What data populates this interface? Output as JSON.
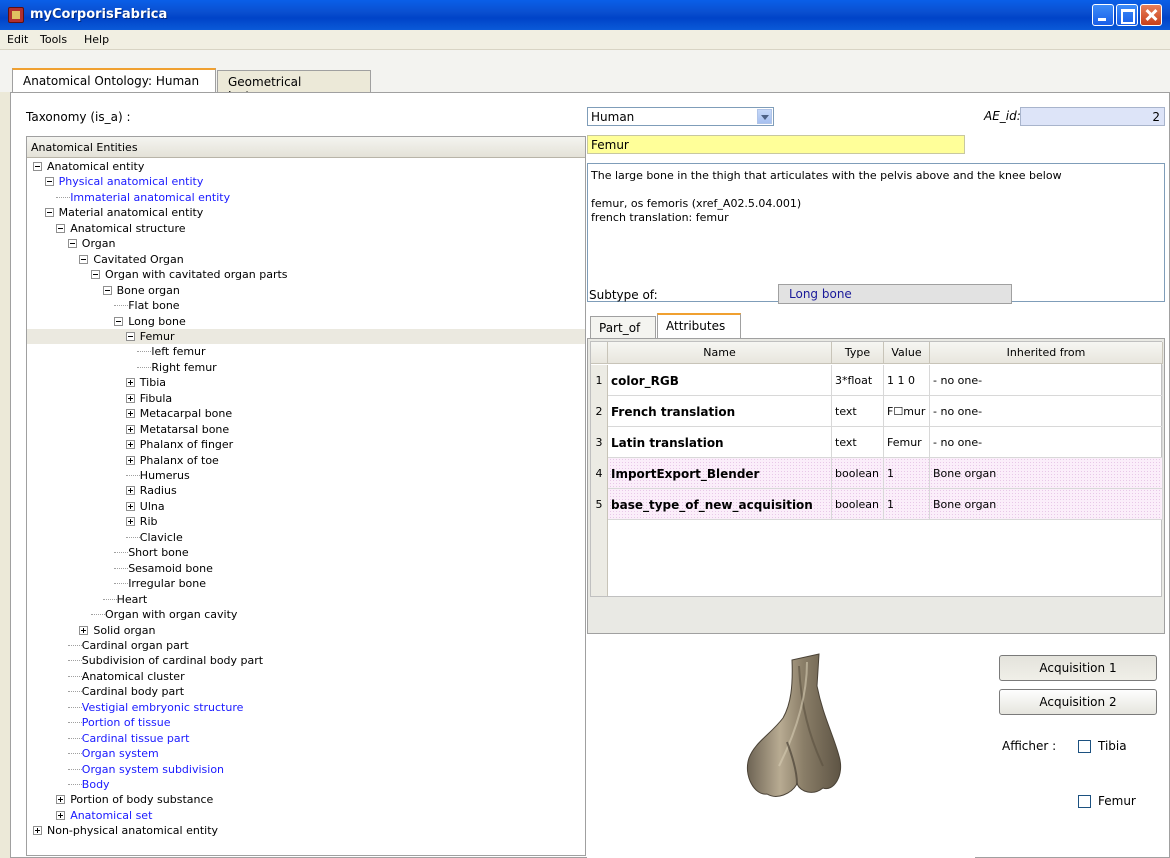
{
  "window": {
    "title": "myCorporisFabrica"
  },
  "menu": [
    "Edit",
    "Tools",
    "Help"
  ],
  "tabs": [
    "Anatomical Ontology: Human",
    "Geometrical Instances"
  ],
  "taxonomy_label": "Taxonomy (is_a) :",
  "tree_header": "Anatomical Entities",
  "tree": [
    {
      "label": "Anatomical entity",
      "exp": "minus"
    },
    {
      "label": "Physical anatomical entity",
      "exp": "minus",
      "blue": true
    },
    {
      "label": "Immaterial anatomical entity",
      "exp": "leaf",
      "blue": true
    },
    {
      "label": "Material anatomical entity",
      "exp": "minus"
    },
    {
      "label": "Anatomical structure",
      "exp": "minus"
    },
    {
      "label": "Organ",
      "exp": "minus"
    },
    {
      "label": "Cavitated Organ",
      "exp": "minus"
    },
    {
      "label": "Organ with cavitated organ parts",
      "exp": "minus"
    },
    {
      "label": "Bone organ",
      "exp": "minus"
    },
    {
      "label": "Flat bone",
      "exp": "leaf"
    },
    {
      "label": "Long bone",
      "exp": "minus"
    },
    {
      "label": "Femur",
      "exp": "minus",
      "selected": true
    },
    {
      "label": "left femur",
      "exp": "leaf"
    },
    {
      "label": "Right femur",
      "exp": "leaf"
    },
    {
      "label": "Tibia",
      "exp": "plus"
    },
    {
      "label": "Fibula",
      "exp": "plus"
    },
    {
      "label": "Metacarpal bone",
      "exp": "plus"
    },
    {
      "label": "Metatarsal bone",
      "exp": "plus"
    },
    {
      "label": "Phalanx of finger",
      "exp": "plus"
    },
    {
      "label": "Phalanx of toe",
      "exp": "plus"
    },
    {
      "label": "Humerus",
      "exp": "leaf"
    },
    {
      "label": "Radius",
      "exp": "plus"
    },
    {
      "label": "Ulna",
      "exp": "plus"
    },
    {
      "label": "Rib",
      "exp": "plus"
    },
    {
      "label": "Clavicle",
      "exp": "leaf"
    },
    {
      "label": "Short bone",
      "exp": "leaf"
    },
    {
      "label": "Sesamoid bone",
      "exp": "leaf"
    },
    {
      "label": "Irregular bone",
      "exp": "leaf"
    },
    {
      "label": "Heart",
      "exp": "leaf"
    },
    {
      "label": "Organ with organ cavity",
      "exp": "leaf"
    },
    {
      "label": "Solid organ",
      "exp": "plus"
    },
    {
      "label": "Cardinal organ part",
      "exp": "leaf"
    },
    {
      "label": "Subdivision of cardinal body part",
      "exp": "leaf"
    },
    {
      "label": "Anatomical cluster",
      "exp": "leaf"
    },
    {
      "label": "Cardinal body part",
      "exp": "leaf"
    },
    {
      "label": "Vestigial embryonic structure",
      "exp": "leaf",
      "blue": true
    },
    {
      "label": "Portion of tissue",
      "exp": "leaf",
      "blue": true
    },
    {
      "label": "Cardinal tissue part",
      "exp": "leaf",
      "blue": true
    },
    {
      "label": "Organ system",
      "exp": "leaf",
      "blue": true
    },
    {
      "label": "Organ system subdivision",
      "exp": "leaf",
      "blue": true
    },
    {
      "label": "Body",
      "exp": "leaf",
      "blue": true
    },
    {
      "label": "Portion of body substance",
      "exp": "plus"
    },
    {
      "label": "Anatomical set",
      "exp": "plus",
      "blue": true
    },
    {
      "label": "Non-physical anatomical entity",
      "exp": "plus"
    }
  ],
  "species": "Human",
  "ae_id_label": "AE_id:",
  "ae_id_value": "2",
  "entity_name": "Femur",
  "description": {
    "line1": "The large bone in the thigh that articulates with the pelvis above and the knee below",
    "line2": "femur, os femoris (xref_A02.5.04.001)",
    "line3": "french translation: femur"
  },
  "subtype_label": "Subtype of:",
  "subtype_value": "Long bone",
  "subtabs": [
    "Part_of",
    "Attributes"
  ],
  "attr_headers": [
    "Name",
    "Type",
    "Value",
    "Inherited from"
  ],
  "attributes": [
    {
      "n": "1",
      "name": "color_RGB",
      "type": "3*float",
      "value": "1 1 0",
      "from": "- no one-",
      "pink": false
    },
    {
      "n": "2",
      "name": "French translation",
      "type": "text",
      "value": "F☐mur",
      "from": "- no one-",
      "pink": false
    },
    {
      "n": "3",
      "name": "Latin translation",
      "type": "text",
      "value": "Femur",
      "from": "- no one-",
      "pink": false
    },
    {
      "n": "4",
      "name": "ImportExport_Blender",
      "type": "boolean",
      "value": "1",
      "from": "Bone organ",
      "pink": true
    },
    {
      "n": "5",
      "name": "base_type_of_new_acquisition",
      "type": "boolean",
      "value": "1",
      "from": "Bone organ",
      "pink": true
    }
  ],
  "buttons": {
    "acq1": "Acquisition 1",
    "acq2": "Acquisition 2"
  },
  "afficher_label": "Afficher :",
  "checkboxes": {
    "tibia": "Tibia",
    "femur": "Femur"
  },
  "colors": {
    "title_bar": "#0a4fd0",
    "name_field": "#ffff99",
    "ae_id_box": "#dde4f8",
    "link_blue": "#1a1aff",
    "inherited_row": "#fbeefa"
  }
}
